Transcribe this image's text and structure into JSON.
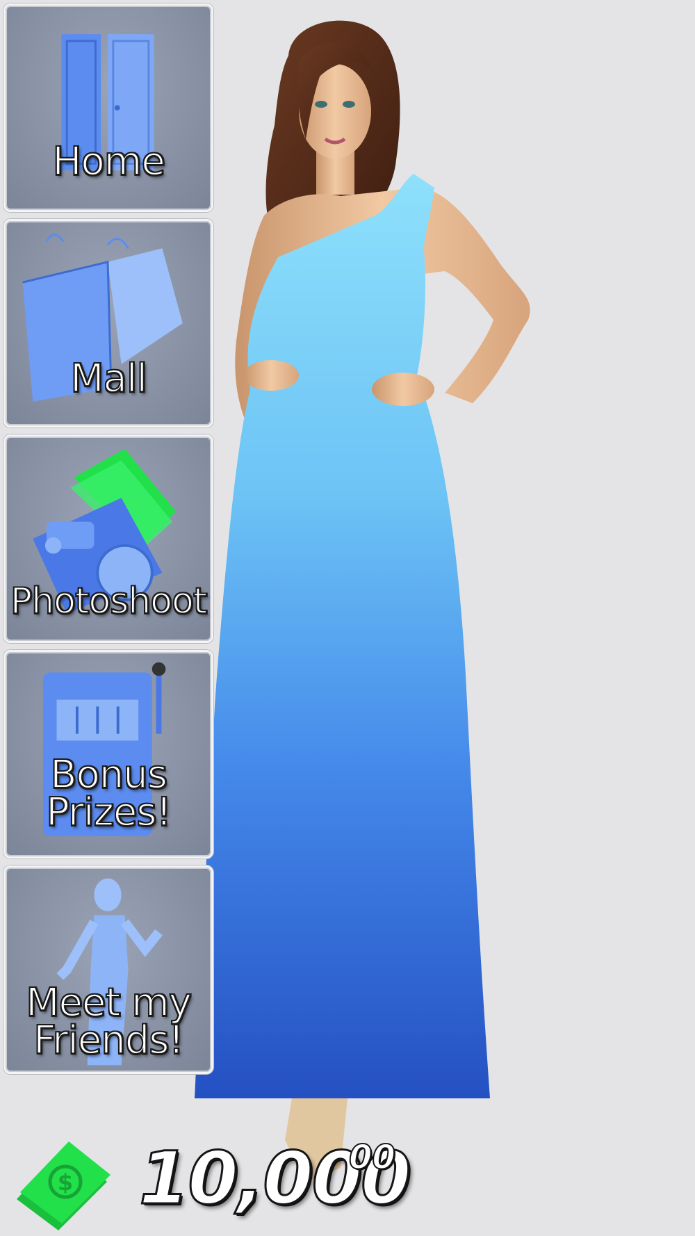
{
  "menu": {
    "items": [
      {
        "label": "Home",
        "icon": "door-icon"
      },
      {
        "label": "Mall",
        "icon": "shopping-bags-icon"
      },
      {
        "label": "Photoshoot",
        "icon": "camera-cash-icon"
      },
      {
        "label": "Bonus\nPrizes!",
        "icon": "slot-machine-icon"
      },
      {
        "label": "Meet my\nFriends!",
        "icon": "friend-figure-icon"
      }
    ]
  },
  "wallet": {
    "amount": "10,000",
    "cents": "00",
    "icon": "cash-icon"
  },
  "colors": {
    "tile_icon_blue": "#5c8cf0",
    "cash_green": "#22e04a",
    "dress_top": "#7fd4f7",
    "dress_bottom": "#2a57c9"
  }
}
